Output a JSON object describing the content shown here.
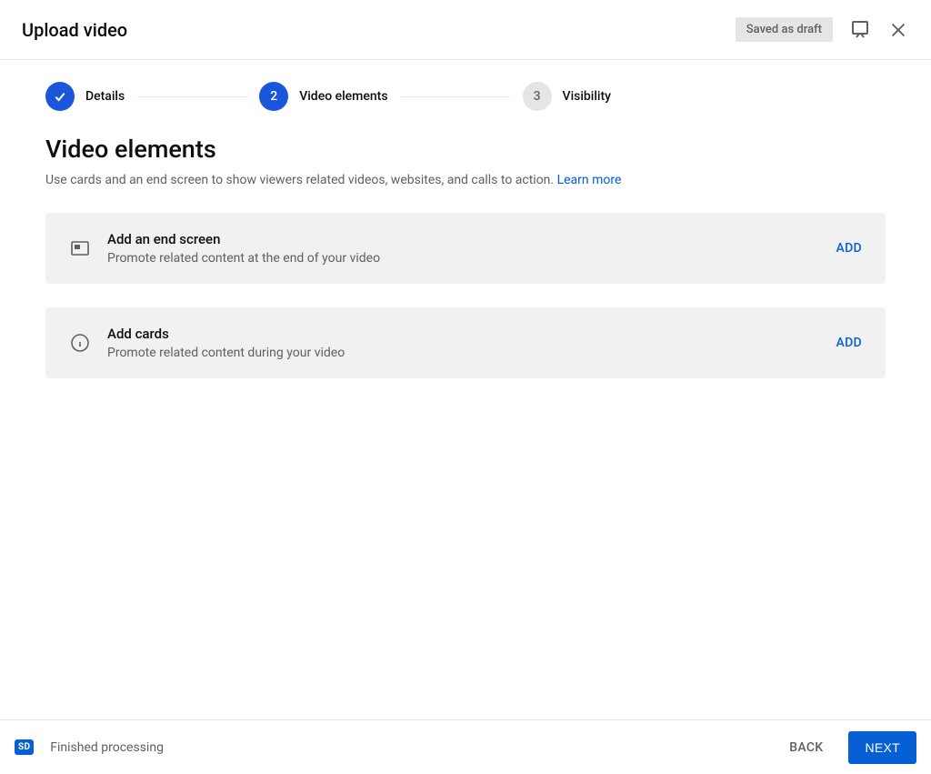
{
  "header": {
    "title": "Upload video",
    "draft_badge": "Saved as draft"
  },
  "stepper": {
    "steps": [
      {
        "label": "Details",
        "state": "done"
      },
      {
        "label": "Video elements",
        "num": "2",
        "state": "active"
      },
      {
        "label": "Visibility",
        "num": "3",
        "state": "pending"
      }
    ]
  },
  "section": {
    "title": "Video elements",
    "desc": "Use cards and an end screen to show viewers related videos, websites, and calls to action. ",
    "learn_more": "Learn more"
  },
  "cards": [
    {
      "title": "Add an end screen",
      "desc": "Promote related content at the end of your video",
      "action": "ADD"
    },
    {
      "title": "Add cards",
      "desc": "Promote related content during your video",
      "action": "ADD"
    }
  ],
  "footer": {
    "sd": "SD",
    "status": "Finished processing",
    "back": "BACK",
    "next": "NEXT"
  }
}
